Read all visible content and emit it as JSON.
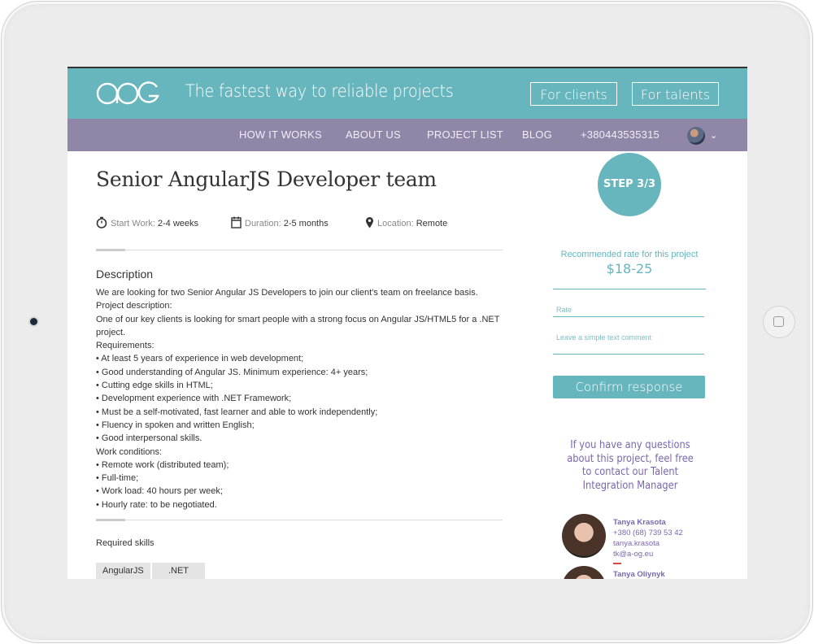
{
  "header": {
    "logo_text": "AOG",
    "tagline": "The fastest way to reliable projects",
    "buttons": {
      "clients": "For clients",
      "talents": "For talents"
    }
  },
  "nav": {
    "items": [
      "HOW IT WORKS",
      "ABOUT US",
      "PROJECT LIST",
      "BLOG",
      "+380443535315"
    ]
  },
  "project": {
    "title": "Senior AngularJS Developer team",
    "meta": {
      "start_label": "Start Work:",
      "start_value": "2-4 weeks",
      "duration_label": "Duration:",
      "duration_value": "2-5 months",
      "location_label": "Location:",
      "location_value": "Remote"
    },
    "description_heading": "Description",
    "description_lines": [
      "We are looking for two Senior Angular JS Developers to join our client’s team on freelance basis.",
      "Project description:",
      "One of our key clients is looking for smart people with a strong focus on Angular JS/HTML5 for a .NET project.",
      "Requirements:",
      "• At least 5 years of experience in web development;",
      "• Good understanding of Angular JS. Minimum experience: 4+ years;",
      "• Cutting edge skills in HTML;",
      "• Development experience with .NET Framework;",
      "• Must be a self-motivated, fast learner and able to work independently;",
      "• Fluency in spoken and written English;",
      "• Good interpersonal skills.",
      "Work conditions:",
      "• Remote work (distributed team);",
      "• Full-time;",
      "• Work load: 40 hours per week;",
      "• Hourly rate: to be negotiated."
    ],
    "skills_heading": "Required skills",
    "skills": [
      "AngularJS",
      ".NET"
    ]
  },
  "sidebar": {
    "step": "STEP 3/3",
    "rate_label": "Recommended rate for this project",
    "rate_value": "$18-25",
    "rate_placeholder": "Rate",
    "comment_placeholder": "Leave a simple text comment",
    "confirm_label": "Confirm response",
    "question": "If you have any questions about this project, feel free to contact our Talent Integration Manager",
    "contacts": [
      {
        "name": "Tanya Krasota",
        "phone": "+380 (68) 739 53 42",
        "skype": "tanya.krasota",
        "email": "tk@a-og.eu"
      },
      {
        "name": "Tanya Oliynyk"
      }
    ]
  },
  "colors": {
    "teal": "#67b5bd",
    "purple": "#8f86a8",
    "contact_text": "#7a66b0"
  }
}
